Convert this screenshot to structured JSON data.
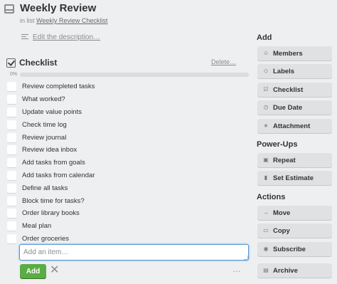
{
  "card": {
    "title": "Weekly Review",
    "in_list_prefix": "in list",
    "list_name": "Weekly Review Checklist",
    "edit_description": "Edit the description…"
  },
  "checklist": {
    "title": "Checklist",
    "delete_label": "Delete…",
    "progress_label": "0%",
    "progress": 0,
    "items": [
      "Review completed tasks",
      "What worked?",
      "Update value points",
      "Check time log",
      "Review journal",
      "Review idea inbox",
      "Add tasks from goals",
      "Add tasks from calendar",
      "Define all tasks",
      "Block time for tasks?",
      "Order library books",
      "Meal plan",
      "Order groceries"
    ],
    "add_placeholder": "Add an item…",
    "add_button": "Add",
    "cancel": "✕",
    "more": "…"
  },
  "sidebar": {
    "add_heading": "Add",
    "add_buttons": [
      {
        "label": "Members",
        "icon": "person-icon"
      },
      {
        "label": "Labels",
        "icon": "label-icon"
      },
      {
        "label": "Checklist",
        "icon": "checklist-icon"
      },
      {
        "label": "Due Date",
        "icon": "clock-icon"
      },
      {
        "label": "Attachment",
        "icon": "paperclip-icon"
      }
    ],
    "powerups_heading": "Power-Ups",
    "powerup_buttons": [
      {
        "label": "Repeat",
        "icon": "repeat-icon"
      },
      {
        "label": "Set Estimate",
        "icon": "estimate-icon"
      }
    ],
    "actions_heading": "Actions",
    "action_buttons": [
      {
        "label": "Move",
        "icon": "arrow-right-icon"
      },
      {
        "label": "Copy",
        "icon": "copy-icon"
      },
      {
        "label": "Subscribe",
        "icon": "eye-icon"
      },
      {
        "label": "Archive",
        "icon": "archive-icon"
      }
    ]
  },
  "colors": {
    "accent_green": "#5aac44",
    "background": "#edeff0",
    "focus_blue": "#5b9bd5"
  }
}
